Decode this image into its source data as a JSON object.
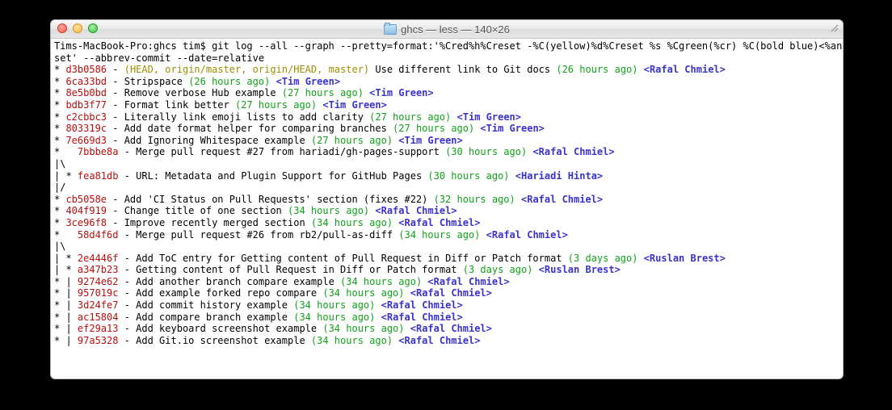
{
  "window": {
    "title": "ghcs — less — 140×26"
  },
  "prompt": "Tims-MacBook-Pro:ghcs tim$ ",
  "command": "git log --all --graph --pretty=format:'%Cred%h%Creset -%C(yellow)%d%Creset %s %Cgreen(%cr) %C(bold blue)<%an>%Creset' --abbrev-commit --date=relative",
  "lines": [
    {
      "graph": "* ",
      "indent": "",
      "hash": "d3b0586",
      "dash": " - ",
      "refs": "(HEAD, origin/master, origin/HEAD, master)",
      "subject": " Use different link to Git docs ",
      "time": "(26 hours ago)",
      "author": " <Rafal Chmiel>"
    },
    {
      "graph": "* ",
      "indent": "",
      "hash": "6ca33bd",
      "dash": " - ",
      "refs": "",
      "subject": "Stripspace ",
      "time": "(26 hours ago)",
      "author": " <Tim Green>"
    },
    {
      "graph": "* ",
      "indent": "",
      "hash": "8e5b0bd",
      "dash": " - ",
      "refs": "",
      "subject": "Remove verbose Hub example ",
      "time": "(27 hours ago)",
      "author": " <Tim Green>"
    },
    {
      "graph": "* ",
      "indent": "",
      "hash": "bdb3f77",
      "dash": " - ",
      "refs": "",
      "subject": "Format link better ",
      "time": "(27 hours ago)",
      "author": " <Tim Green>"
    },
    {
      "graph": "* ",
      "indent": "",
      "hash": "c2cbbc3",
      "dash": " - ",
      "refs": "",
      "subject": "Literally link emoji lists to add clarity ",
      "time": "(27 hours ago)",
      "author": " <Tim Green>"
    },
    {
      "graph": "* ",
      "indent": "",
      "hash": "803319c",
      "dash": " - ",
      "refs": "",
      "subject": "Add date format helper for comparing branches ",
      "time": "(27 hours ago)",
      "author": " <Tim Green>"
    },
    {
      "graph": "* ",
      "indent": "",
      "hash": "7e669d3",
      "dash": " - ",
      "refs": "",
      "subject": "Add Ignoring Whitespace example ",
      "time": "(27 hours ago)",
      "author": " <Tim Green>"
    },
    {
      "graph": "*   ",
      "indent": "",
      "hash": "7bbbe8a",
      "dash": " - ",
      "refs": "",
      "subject": "Merge pull request #27 from hariadi/gh-pages-support ",
      "time": "(30 hours ago)",
      "author": " <Rafal Chmiel>"
    },
    {
      "graph": "|\\  ",
      "raw": true
    },
    {
      "graph": "| * ",
      "indent": "",
      "hash": "fea81db",
      "dash": " - ",
      "refs": "",
      "subject": "URL: Metadata and Plugin Support for GitHub Pages ",
      "time": "(30 hours ago)",
      "author": " <Hariadi Hinta>"
    },
    {
      "graph": "|/  ",
      "raw": true
    },
    {
      "graph": "* ",
      "indent": "",
      "hash": "cb5058e",
      "dash": " - ",
      "refs": "",
      "subject": "Add 'CI Status on Pull Requests' section (fixes #22) ",
      "time": "(32 hours ago)",
      "author": " <Rafal Chmiel>"
    },
    {
      "graph": "* ",
      "indent": "",
      "hash": "404f919",
      "dash": " - ",
      "refs": "",
      "subject": "Change title of one section ",
      "time": "(34 hours ago)",
      "author": " <Rafal Chmiel>"
    },
    {
      "graph": "* ",
      "indent": "",
      "hash": "3ce96f8",
      "dash": " - ",
      "refs": "",
      "subject": "Improve recently merged section ",
      "time": "(34 hours ago)",
      "author": " <Rafal Chmiel>"
    },
    {
      "graph": "*   ",
      "indent": "",
      "hash": "58d4f6d",
      "dash": " - ",
      "refs": "",
      "subject": "Merge pull request #26 from rb2/pull-as-diff ",
      "time": "(34 hours ago)",
      "author": " <Rafal Chmiel>"
    },
    {
      "graph": "|\\  ",
      "raw": true
    },
    {
      "graph": "| * ",
      "indent": "",
      "hash": "2e4446f",
      "dash": " - ",
      "refs": "",
      "subject": "Add ToC entry for Getting content of Pull Request in Diff or Patch format ",
      "time": "(3 days ago)",
      "author": " <Ruslan Brest>"
    },
    {
      "graph": "| * ",
      "indent": "",
      "hash": "a347b23",
      "dash": " - ",
      "refs": "",
      "subject": "Getting content of Pull Request in Diff or Patch format ",
      "time": "(3 days ago)",
      "author": " <Ruslan Brest>"
    },
    {
      "graph": "* | ",
      "indent": "",
      "hash": "9274e62",
      "dash": " - ",
      "refs": "",
      "subject": "Add another branch compare example ",
      "time": "(34 hours ago)",
      "author": " <Rafal Chmiel>"
    },
    {
      "graph": "* | ",
      "indent": "",
      "hash": "957019c",
      "dash": " - ",
      "refs": "",
      "subject": "Add example forked repo compare ",
      "time": "(34 hours ago)",
      "author": " <Rafal Chmiel>"
    },
    {
      "graph": "* | ",
      "indent": "",
      "hash": "3d24fe7",
      "dash": " - ",
      "refs": "",
      "subject": "Add commit history example ",
      "time": "(34 hours ago)",
      "author": " <Rafal Chmiel>"
    },
    {
      "graph": "* | ",
      "indent": "",
      "hash": "ac15804",
      "dash": " - ",
      "refs": "",
      "subject": "Add compare branch example ",
      "time": "(34 hours ago)",
      "author": " <Rafal Chmiel>"
    },
    {
      "graph": "* | ",
      "indent": "",
      "hash": "ef29a13",
      "dash": " - ",
      "refs": "",
      "subject": "Add keyboard screenshot example ",
      "time": "(34 hours ago)",
      "author": " <Rafal Chmiel>"
    },
    {
      "graph": "* | ",
      "indent": "",
      "hash": "97a5328",
      "dash": " - ",
      "refs": "",
      "subject": "Add Git.io screenshot example ",
      "time": "(34 hours ago)",
      "author": " <Rafal Chmiel>"
    }
  ]
}
